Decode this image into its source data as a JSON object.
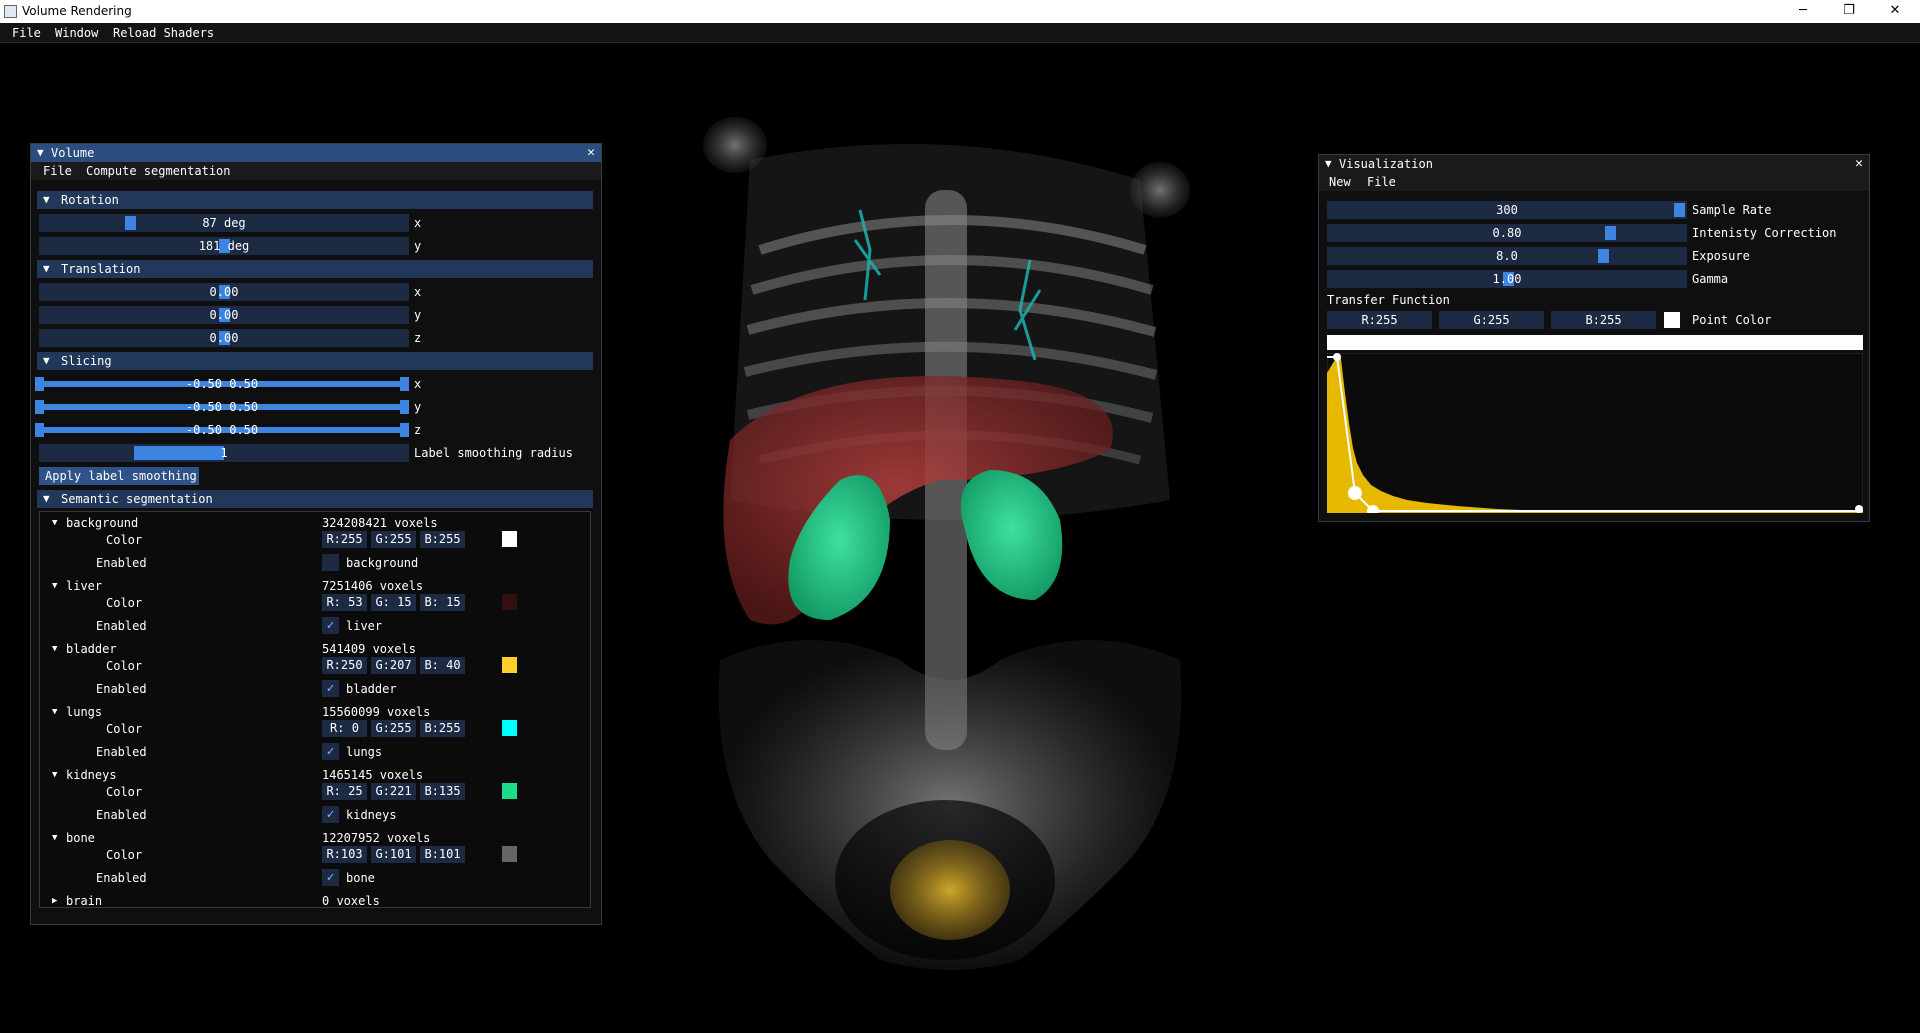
{
  "window": {
    "title": "Volume Rendering",
    "minimize": "─",
    "maximize": "❐",
    "close": "✕"
  },
  "menubar": {
    "file": "File",
    "window": "Window",
    "reload": "Reload Shaders"
  },
  "volume": {
    "title": "Volume",
    "menu": {
      "file": "File",
      "compute": "Compute segmentation"
    },
    "rotation": {
      "header": "Rotation",
      "x": {
        "value": "87 deg",
        "axis": "x",
        "fraction": 0.24
      },
      "y": {
        "value": "181 deg",
        "axis": "y",
        "fraction": 0.5
      }
    },
    "translation": {
      "header": "Translation",
      "x": {
        "value": "0.00",
        "axis": "x"
      },
      "y": {
        "value": "0.00",
        "axis": "y"
      },
      "z": {
        "value": "0.00",
        "axis": "z"
      }
    },
    "slicing": {
      "header": "Slicing",
      "x": {
        "value": "-0.50 0.50",
        "axis": "x"
      },
      "y": {
        "value": "-0.50 0.50",
        "axis": "y"
      },
      "z": {
        "value": "-0.50 0.50",
        "axis": "z"
      }
    },
    "smoothing": {
      "value": "1",
      "label": "Label smoothing radius",
      "button": "Apply label smoothing"
    },
    "segmentation": {
      "header": "Semantic segmentation",
      "color_label": "Color",
      "enabled_label": "Enabled",
      "labels": [
        {
          "name": "background",
          "voxels": "324208421 voxels",
          "r": "R:255",
          "g": "G:255",
          "b": "B:255",
          "color": "#ffffff",
          "enabled": false
        },
        {
          "name": "liver",
          "voxels": "7251406 voxels",
          "r": "R: 53",
          "g": "G: 15",
          "b": "B: 15",
          "color": "#350f0f",
          "enabled": true
        },
        {
          "name": "bladder",
          "voxels": "541409 voxels",
          "r": "R:250",
          "g": "G:207",
          "b": "B: 40",
          "color": "#facf28",
          "enabled": true
        },
        {
          "name": "lungs",
          "voxels": "15560099 voxels",
          "r": "R:  0",
          "g": "G:255",
          "b": "B:255",
          "color": "#00ffff",
          "enabled": true
        },
        {
          "name": "kidneys",
          "voxels": "1465145 voxels",
          "r": "R: 25",
          "g": "G:221",
          "b": "B:135",
          "color": "#19dd87",
          "enabled": true
        },
        {
          "name": "bone",
          "voxels": "12207952 voxels",
          "r": "R:103",
          "g": "G:101",
          "b": "B:101",
          "color": "#676565",
          "enabled": true
        }
      ],
      "brain": {
        "name": "brain",
        "voxels": "0 voxels"
      }
    }
  },
  "visualization": {
    "title": "Visualization",
    "menu": {
      "new": "New",
      "file": "File"
    },
    "sample_rate": {
      "value": "300",
      "label": "Sample Rate"
    },
    "intensity": {
      "value": "0.80",
      "label": "Intenisty Correction"
    },
    "exposure": {
      "value": "8.0",
      "label": "Exposure"
    },
    "gamma": {
      "value": "1.00",
      "label": "Gamma"
    },
    "transfer_function": "Transfer Function",
    "point_color": {
      "r": "R:255",
      "g": "G:255",
      "b": "B:255",
      "label": "Point Color",
      "color": "#ffffff"
    },
    "histogram_color": "#e6b800"
  }
}
